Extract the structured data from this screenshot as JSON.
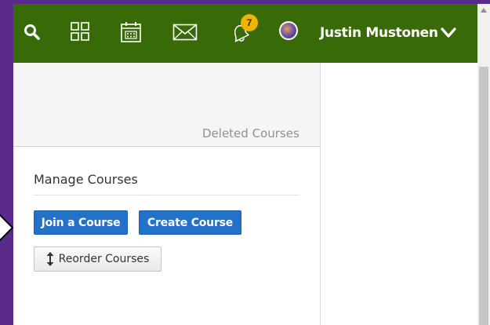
{
  "header": {
    "icons": [
      "search-icon",
      "apps-grid-icon",
      "calendar-icon",
      "mail-icon",
      "bell-icon"
    ],
    "notification_count": "7",
    "username": "Justin Mustonen"
  },
  "courses": {
    "deleted_label": "Deleted Courses",
    "manage_title": "Manage Courses",
    "join_label": "Join a Course",
    "create_label": "Create Course",
    "reorder_label": "Reorder Courses"
  },
  "colors": {
    "header_green": "#386a07",
    "accent_purple": "#5a2a8c",
    "button_blue": "#2372c9",
    "badge_yellow": "#f0b400"
  }
}
